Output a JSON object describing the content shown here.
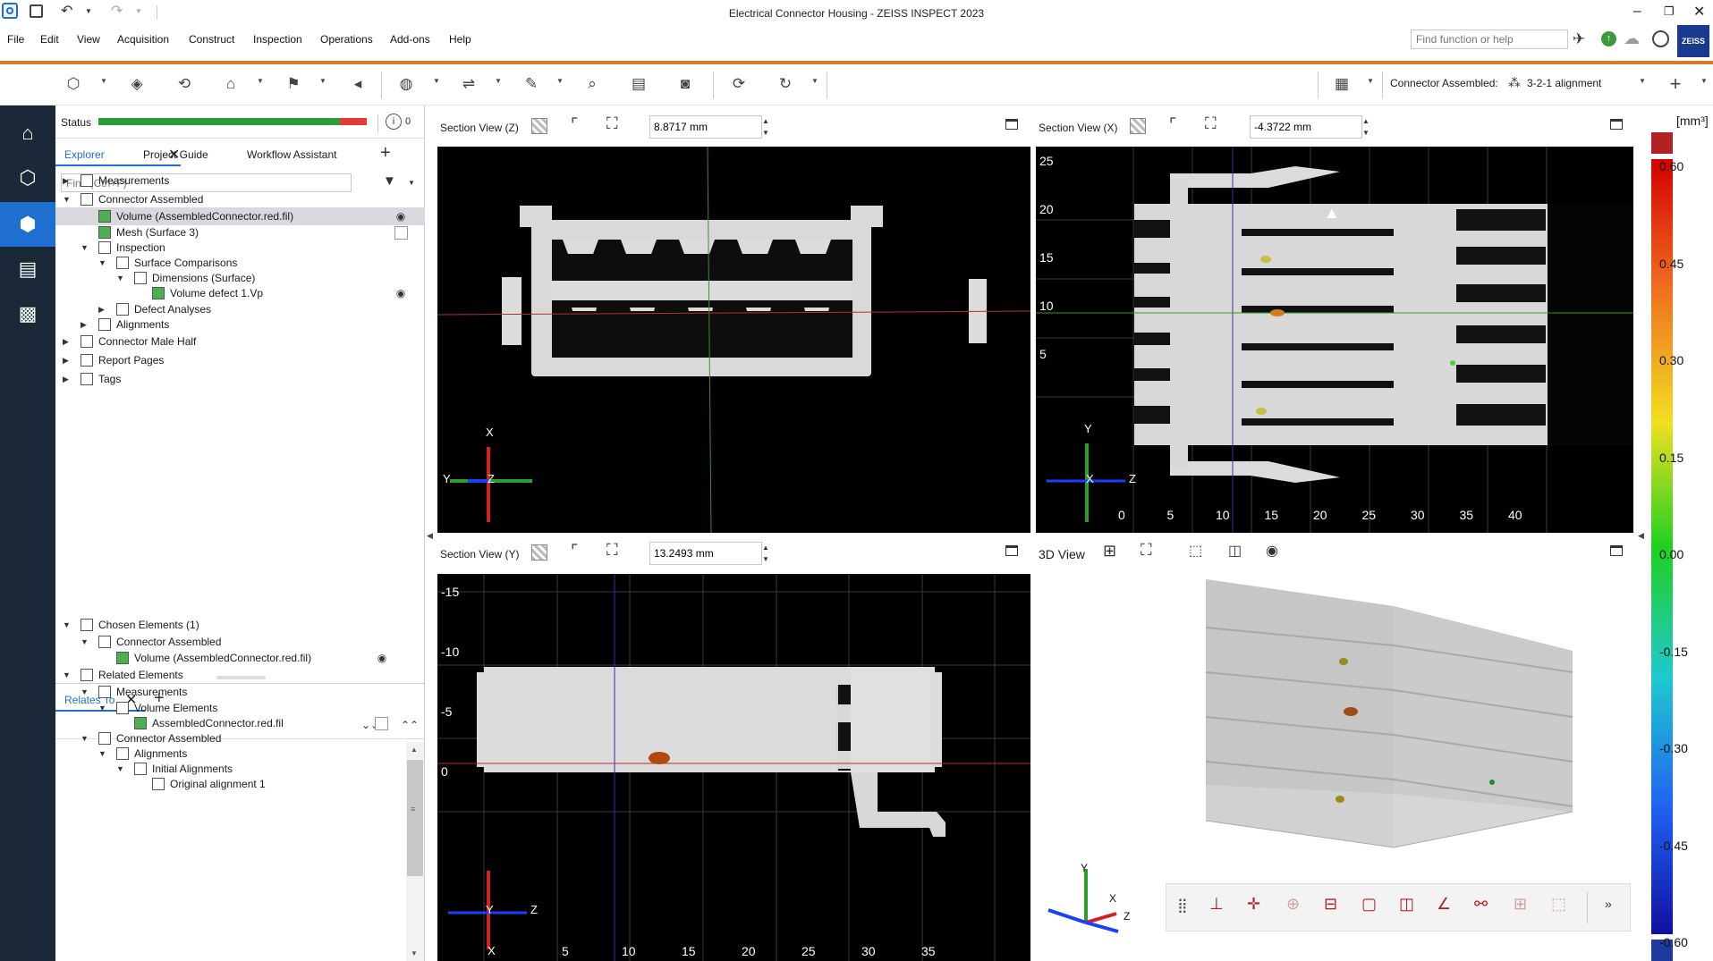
{
  "app": {
    "title": "Electrical Connector Housing - ZEISS INSPECT 2023",
    "brand": "ZEISS",
    "accent": "#1f6fd1",
    "orange": "#d77a2a"
  },
  "menu": [
    "File",
    "Edit",
    "View",
    "Acquisition",
    "Construct",
    "Inspection",
    "Operations",
    "Add-ons",
    "Help"
  ],
  "search": {
    "placeholder": "Find function or help"
  },
  "toolbar": {
    "context_label": "Connector Assembled:",
    "alignment": "3-2-1 alignment"
  },
  "status": {
    "label": "Status",
    "info_count": "0",
    "progress": 0.9
  },
  "explorer": {
    "tabs": [
      "Explorer",
      "Project Guide",
      "Workflow Assistant"
    ],
    "find_placeholder": "Find (Ctrl+F)",
    "tree": [
      {
        "label": "Measurements",
        "icon": "measurements-icon"
      },
      {
        "label": "Connector Assembled",
        "icon": "part-icon"
      },
      {
        "label": "Volume (AssembledConnector.red.fil)",
        "icon": "volume-icon",
        "selected": true
      },
      {
        "label": "Mesh (Surface 3)",
        "icon": "mesh-icon"
      },
      {
        "label": "Inspection",
        "icon": "folder-icon"
      },
      {
        "label": "Surface Comparisons",
        "icon": "surface-comparison-icon"
      },
      {
        "label": "Dimensions (Surface)",
        "icon": "dimensions-icon"
      },
      {
        "label": "Volume defect 1.Vp",
        "icon": "volume-defect-icon"
      },
      {
        "label": "Defect Analyses",
        "icon": "defect-analysis-icon"
      },
      {
        "label": "Alignments",
        "icon": "alignment-icon"
      },
      {
        "label": "Connector Male Half",
        "icon": "part-icon"
      },
      {
        "label": "Report Pages",
        "icon": "camera-icon"
      },
      {
        "label": "Tags",
        "icon": "tag-icon"
      }
    ]
  },
  "relates": {
    "tab": "Relates To",
    "tree": [
      {
        "label": "Chosen Elements (1)",
        "icon": "pointer-icon"
      },
      {
        "label": "Connector Assembled",
        "icon": "part-icon"
      },
      {
        "label": "Volume (AssembledConnector.red.fil)",
        "icon": "volume-icon"
      },
      {
        "label": "Related Elements",
        "icon": "related-icon"
      },
      {
        "label": "Measurements",
        "icon": "measurements-icon"
      },
      {
        "label": "Volume Elements",
        "icon": "volume-elements-icon"
      },
      {
        "label": "AssembledConnector.red.fil",
        "icon": "volume-icon"
      },
      {
        "label": "Connector Assembled",
        "icon": "part-icon"
      },
      {
        "label": "Alignments",
        "icon": "alignment-icon"
      },
      {
        "label": "Initial Alignments",
        "icon": "folder-icon"
      },
      {
        "label": "Original alignment 1",
        "icon": "alignment-icon"
      }
    ]
  },
  "views": {
    "z": {
      "title": "Section View (Z)",
      "value": "8.8717 mm"
    },
    "x": {
      "title": "Section View (X)",
      "value": "-4.3722 mm",
      "y_ticks": [
        "25",
        "20",
        "15",
        "10",
        "5"
      ],
      "x_ticks": [
        "0",
        "5",
        "10",
        "15",
        "20",
        "25",
        "30",
        "35",
        "40"
      ]
    },
    "y": {
      "title": "Section View (Y)",
      "value": "13.2493 mm",
      "y_ticks": [
        "-15",
        "-10",
        "-5",
        "0"
      ],
      "x_ticks": [
        "5",
        "10",
        "15",
        "20",
        "25",
        "30",
        "35"
      ]
    },
    "v3d": {
      "title": "3D View"
    }
  },
  "axes": {
    "x": "X",
    "y": "Y",
    "z": "Z"
  },
  "colorbar": {
    "unit": "[mm³]",
    "ticks": [
      "0.60",
      "0.45",
      "0.30",
      "0.15",
      "0.00",
      "-0.15",
      "-0.30",
      "-0.45",
      "-0.60"
    ],
    "top_color": "#b22222",
    "bottom_color": "#1e3a9e"
  }
}
